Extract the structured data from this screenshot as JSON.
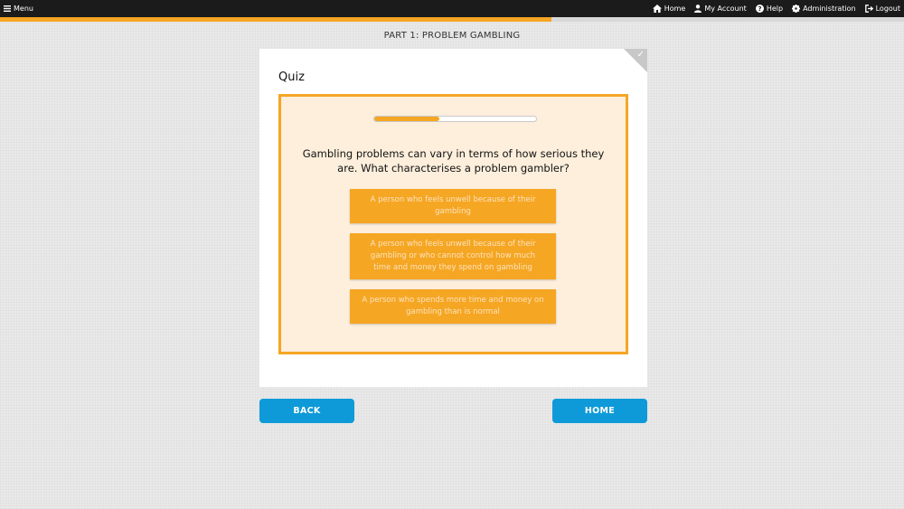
{
  "topbar": {
    "menu_label": "Menu",
    "nav": [
      {
        "label": "Home",
        "icon": "home-icon"
      },
      {
        "label": "My Account",
        "icon": "user-icon"
      },
      {
        "label": "Help",
        "icon": "help-icon"
      },
      {
        "label": "Administration",
        "icon": "gear-icon"
      },
      {
        "label": "Logout",
        "icon": "logout-icon"
      }
    ]
  },
  "course_progress": 0.61,
  "section_title": "PART 1: PROBLEM GAMBLING",
  "card": {
    "title": "Quiz",
    "quiz_progress": 0.4,
    "question": "Gambling problems can vary in terms of how serious they are. What characterises a problem gambler?",
    "answers": [
      "A person who feels unwell because of their gambling",
      "A person who feels unwell because of their gambling or who cannot control how much time and money they spend on gambling",
      "A person who spends more time and money on gambling than is normal"
    ]
  },
  "buttons": {
    "back": "BACK",
    "home": "HOME"
  },
  "colors": {
    "accent": "#f5a623",
    "button": "#0e9ad8",
    "topbar": "#1b1b1b"
  }
}
